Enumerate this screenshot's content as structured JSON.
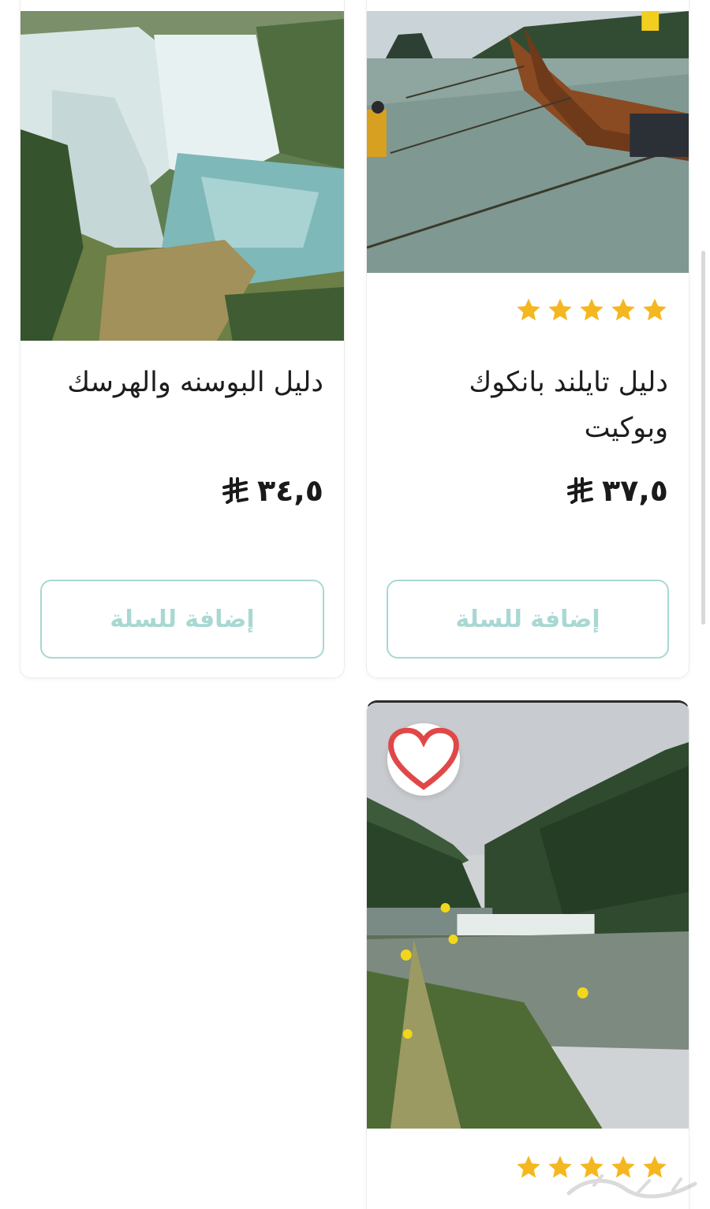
{
  "products": [
    {
      "title": "دليل البوسنه والهرسك",
      "price": "٣٤,٥",
      "cart_label": "إضافة للسلة",
      "image": "waterfall-photo"
    },
    {
      "title": "دليل تايلند بانكوك وبوكيت",
      "price": "٣٧,٥",
      "cart_label": "إضافة للسلة",
      "rating": 5,
      "image": "boats-beach-photo"
    },
    {
      "rating": 5,
      "image": "mountain-lake-photo",
      "favorite_icon": "heart-icon"
    }
  ],
  "colors": {
    "star": "#f5b71f",
    "cart_border": "#a9d8d3",
    "heart": "#e04848"
  },
  "currency_icon": "riyal-symbol-icon",
  "watermark_icon": "haraj-logo-icon"
}
